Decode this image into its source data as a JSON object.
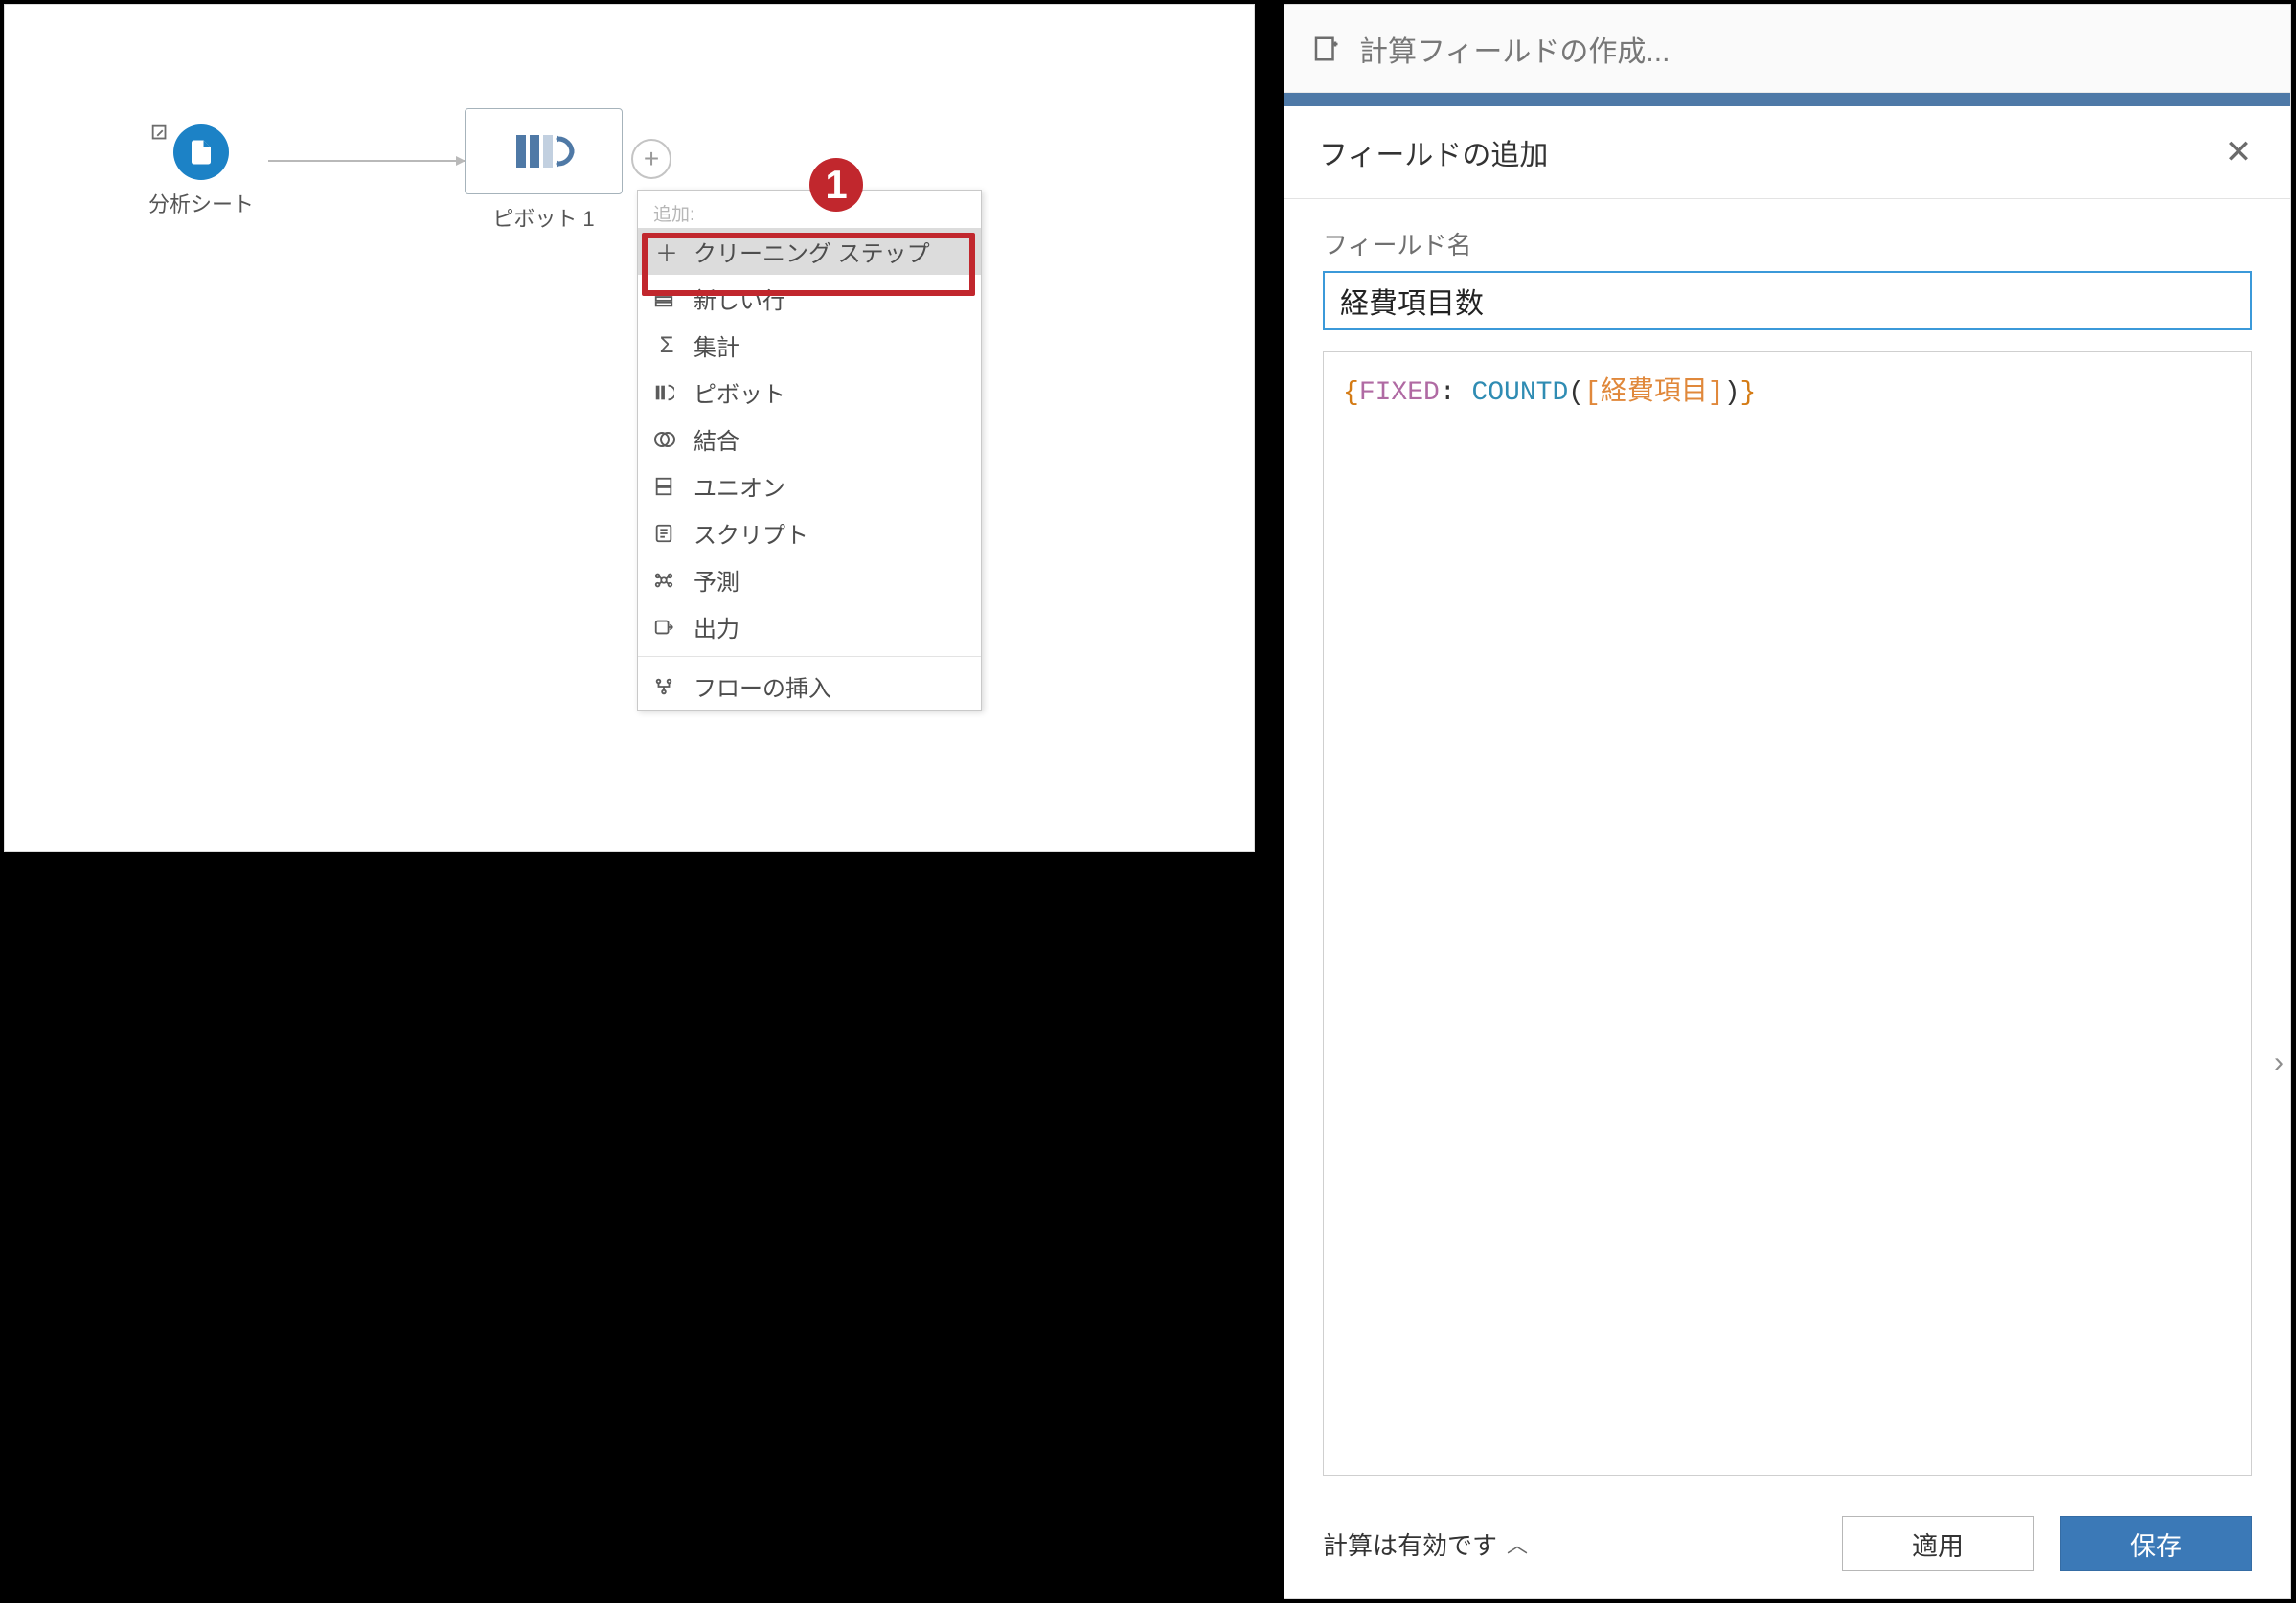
{
  "left": {
    "node_sheet_label": "分析シート",
    "node_pivot_label": "ピボット 1",
    "menu_header": "追加:",
    "menu_items": [
      {
        "label": "クリーニング ステップ",
        "icon": "plus"
      },
      {
        "label": "新しい行",
        "icon": "rows"
      },
      {
        "label": "集計",
        "icon": "sigma"
      },
      {
        "label": "ピボット",
        "icon": "pivot"
      },
      {
        "label": "結合",
        "icon": "join"
      },
      {
        "label": "ユニオン",
        "icon": "union"
      },
      {
        "label": "スクリプト",
        "icon": "script"
      },
      {
        "label": "予測",
        "icon": "predict"
      },
      {
        "label": "出力",
        "icon": "output"
      }
    ],
    "menu_insert_flow": "フローの挿入",
    "callout_number": "1"
  },
  "right": {
    "titlebar": "計算フィールドの作成...",
    "header": "フィールドの追加",
    "field_label": "フィールド名",
    "field_value": "経費項目数",
    "formula_tokens": [
      {
        "t": "{",
        "c": "brace"
      },
      {
        "t": "FIXED",
        "c": "kw"
      },
      {
        "t": ": ",
        "c": "plain"
      },
      {
        "t": "COUNTD",
        "c": "func"
      },
      {
        "t": "(",
        "c": "plain"
      },
      {
        "t": "[経費項目]",
        "c": "field"
      },
      {
        "t": ")",
        "c": "plain"
      },
      {
        "t": "}",
        "c": "brace"
      }
    ],
    "status": "計算は有効です",
    "apply_button": "適用",
    "save_button": "保存"
  }
}
